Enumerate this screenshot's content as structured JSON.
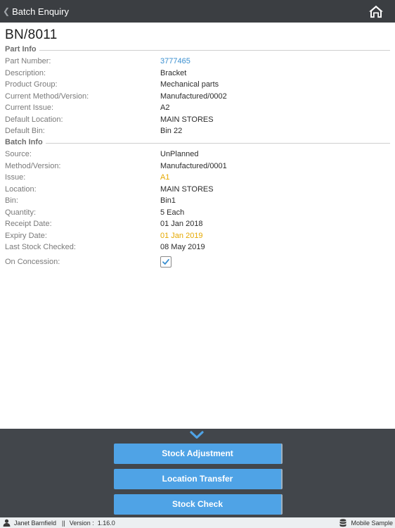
{
  "header": {
    "back_label": "Batch Enquiry"
  },
  "page": {
    "title": "BN/8011"
  },
  "part_info": {
    "heading": "Part Info",
    "rows": [
      {
        "label": "Part Number:",
        "value": "3777465"
      },
      {
        "label": "Description:",
        "value": "Bracket"
      },
      {
        "label": "Product Group:",
        "value": "Mechanical parts"
      },
      {
        "label": "Current Method/Version:",
        "value": "Manufactured/0002"
      },
      {
        "label": "Current Issue:",
        "value": "A2"
      },
      {
        "label": "Default Location:",
        "value": "MAIN STORES"
      },
      {
        "label": "Default Bin:",
        "value": "Bin 22"
      }
    ]
  },
  "batch_info": {
    "heading": "Batch Info",
    "rows": [
      {
        "label": "Source:",
        "value": "UnPlanned"
      },
      {
        "label": "Method/Version:",
        "value": "Manufactured/0001"
      },
      {
        "label": "Issue:",
        "value": "A1"
      },
      {
        "label": "Location:",
        "value": "MAIN STORES"
      },
      {
        "label": "Bin:",
        "value": "Bin1"
      },
      {
        "label": "Quantity:",
        "value": "5 Each"
      },
      {
        "label": "Receipt Date:",
        "value": "01 Jan 2018"
      },
      {
        "label": "Expiry Date:",
        "value": "01 Jan 2019"
      },
      {
        "label": "Last Stock Checked:",
        "value": "08 May 2019"
      }
    ],
    "concession_label": "On Concession:",
    "on_concession": true
  },
  "actions": {
    "stock_adjustment": "Stock Adjustment",
    "location_transfer": "Location Transfer",
    "stock_check": "Stock Check"
  },
  "status_bar": {
    "user": "Janet Barnfield",
    "separator": "||",
    "version_label": "Version :",
    "version": "1.16.0",
    "database": "Mobile Sample"
  },
  "colors": {
    "header_bg": "#3b3e42",
    "link": "#3a8fd0",
    "warning": "#e5a800",
    "button": "#4fa3e6",
    "panel_bg": "#42464b"
  },
  "icons": {
    "back": "chevron-left-icon",
    "home": "home-icon",
    "collapse": "chevron-down-icon",
    "user": "user-icon",
    "database": "database-icon",
    "check": "checkmark-icon"
  }
}
